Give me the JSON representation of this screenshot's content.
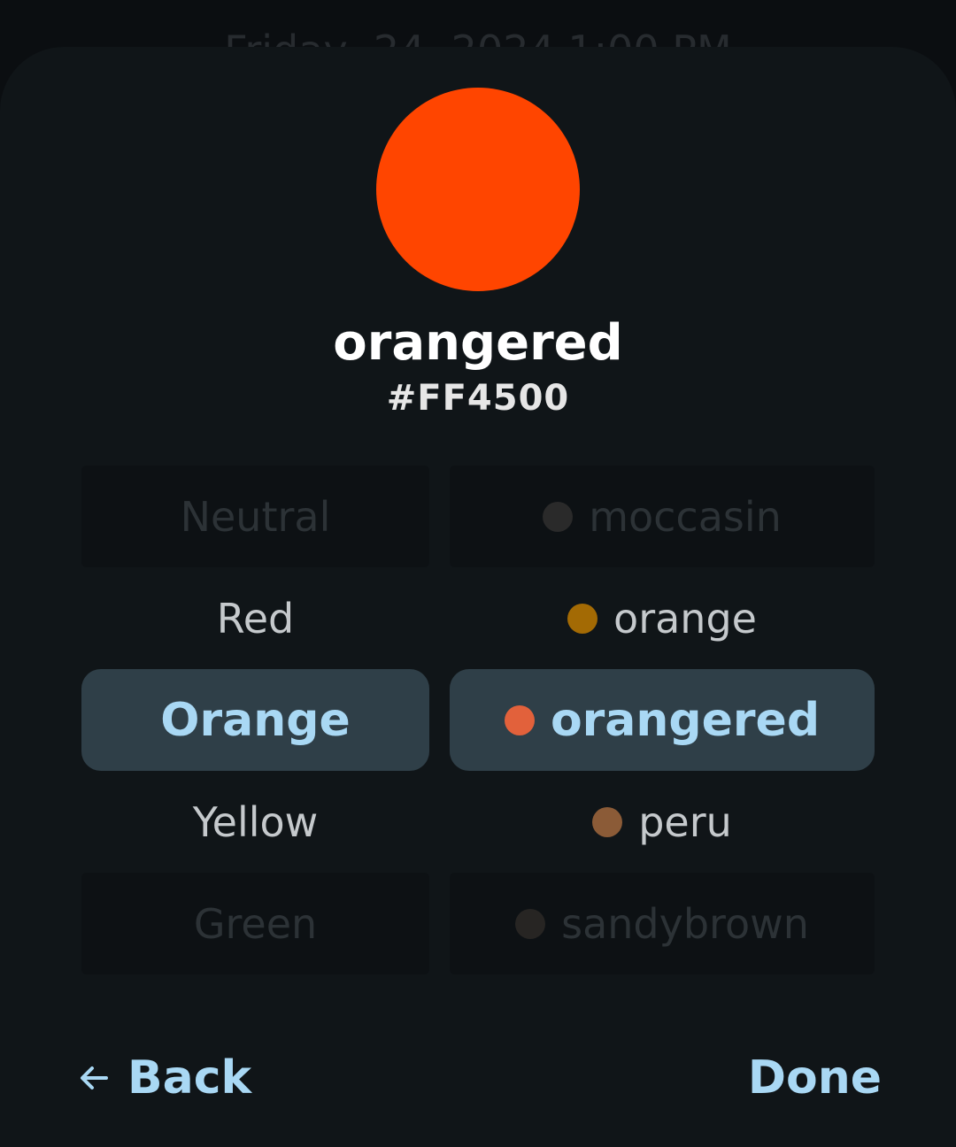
{
  "background": {
    "datetime_text": "Friday, 24, 2024 1:00 PM"
  },
  "selected_color": {
    "name": "orangered",
    "hex": "#FF4500",
    "swatch_color": "#FF4500"
  },
  "families": {
    "items": [
      "Neutral",
      "Red",
      "Orange",
      "Yellow",
      "Green"
    ],
    "selected": "Orange"
  },
  "colors": {
    "items": [
      {
        "name": "moccasin",
        "dot": "#2a2a2a"
      },
      {
        "name": "orange",
        "dot": "#a36a04"
      },
      {
        "name": "orangered",
        "dot": "#e2613b"
      },
      {
        "name": "peru",
        "dot": "#8b5b37"
      },
      {
        "name": "sandybrown",
        "dot": "#272523"
      }
    ],
    "selected": "orangered"
  },
  "footer": {
    "back_label": "Back",
    "done_label": "Done"
  },
  "theme": {
    "accent": "#a9d8f4",
    "selected_row_bg": "#2f3f48",
    "sheet_bg": "#101518"
  }
}
